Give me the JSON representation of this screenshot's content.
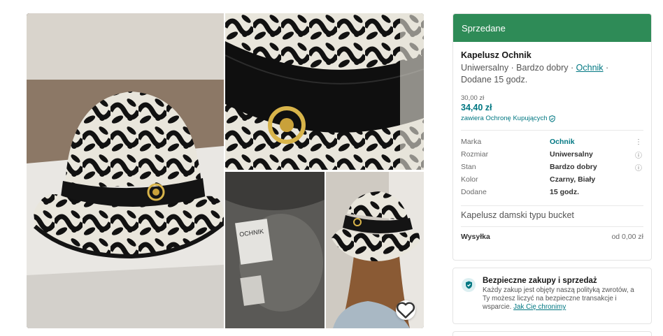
{
  "gallery": {
    "photos": [
      {
        "label": "hat-front-photo"
      },
      {
        "label": "hat-buckle-closeup-photo"
      },
      {
        "label": "hat-inner-label-photo"
      },
      {
        "label": "hat-worn-photo"
      }
    ],
    "inner_label_text": "OCHNIK",
    "favourite_icon": "heart-icon"
  },
  "listing": {
    "status_banner": "Sprzedane",
    "title": "Kapelusz Ochnik",
    "subtitle_prefix": "Uniwersalny · Bardzo dobry · ",
    "brand_link": "Ochnik",
    "subtitle_suffix": " ·",
    "added_line": "Dodane 15 godz.",
    "price": "30,00 zł",
    "price_with_protection": "34,40 zł",
    "protection_note": "zawiera Ochronę Kupujących",
    "details": [
      {
        "key": "Marka",
        "value": "Ochnik",
        "icon": "more-vertical-icon",
        "icon_glyph": "⋮",
        "link": true
      },
      {
        "key": "Rozmiar",
        "value": "Uniwersalny",
        "icon": "info-icon",
        "icon_glyph": "ⓘ",
        "link": false
      },
      {
        "key": "Stan",
        "value": "Bardzo dobry",
        "icon": "info-icon",
        "icon_glyph": "ⓘ",
        "link": false
      },
      {
        "key": "Kolor",
        "value": "Czarny, Biały",
        "icon": "",
        "icon_glyph": "",
        "link": false
      },
      {
        "key": "Dodane",
        "value": "15 godz.",
        "icon": "",
        "icon_glyph": "",
        "link": false
      }
    ],
    "description": "Kapelusz damski typu bucket",
    "shipping_label": "Wysyłka",
    "shipping_value": "od 0,00 zł"
  },
  "safe_purchase": {
    "title": "Bezpieczne zakupy i sprzedaż",
    "text": "Każdy zakup jest objęty naszą polityką zwrotów, a Ty możesz liczyć na bezpieczne transakcje i wsparcie. ",
    "link": "Jak Cię chronimy"
  },
  "colors": {
    "accent": "#007782",
    "sold_banner": "#2e8b57"
  }
}
